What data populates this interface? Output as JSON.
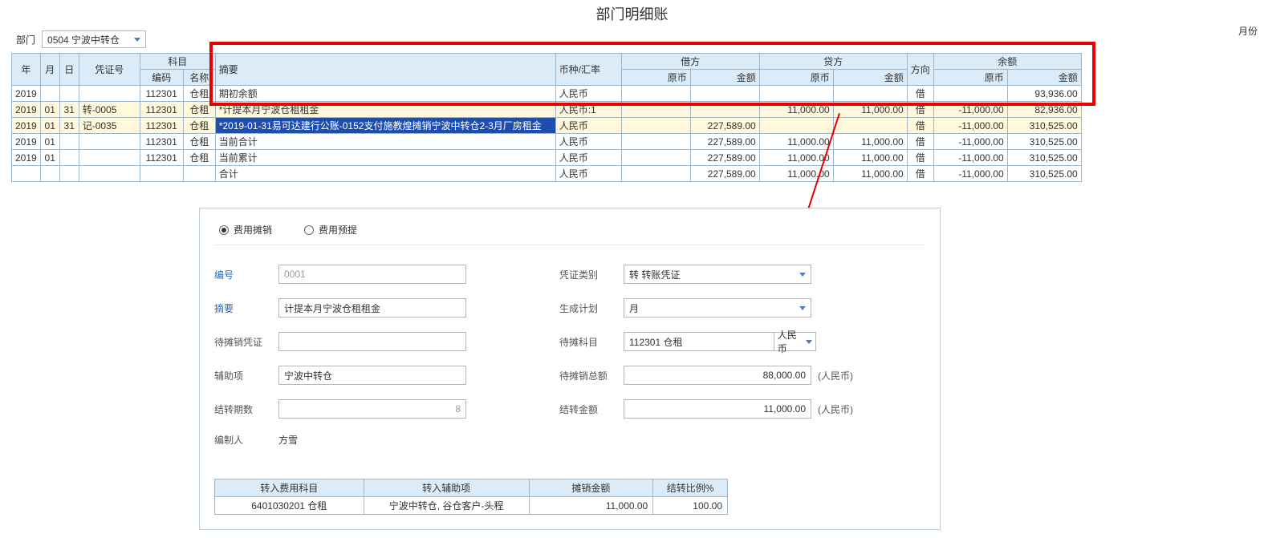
{
  "title": "部门明细账",
  "right_label": "月份",
  "filter": {
    "label": "部门",
    "dept": "0504 宁波中转仓"
  },
  "headers": {
    "year": "年",
    "month": "月",
    "day": "日",
    "voucher": "凭证号",
    "subject": "科目",
    "code": "编码",
    "name": "名称",
    "desc": "摘要",
    "currency": "币种/汇率",
    "debit": "借方",
    "credit": "贷方",
    "orig": "原币",
    "amount": "金额",
    "dir": "方向",
    "balance": "余额"
  },
  "rows": [
    {
      "year": "2019",
      "month": "",
      "day": "",
      "vno": "",
      "code": "112301",
      "name": "仓租",
      "desc": "期初余额",
      "cur": "人民币",
      "od": "",
      "ad": "",
      "oc": "",
      "ac": "",
      "dir": "借",
      "ob": "",
      "ab": "93,936.00",
      "hl": false,
      "sel": false
    },
    {
      "year": "2019",
      "month": "01",
      "day": "31",
      "vno": "转-0005",
      "code": "112301",
      "name": "仓租",
      "desc": "*计提本月宁波仓租租金",
      "cur": "人民币:1",
      "od": "",
      "ad": "",
      "oc": "11,000.00",
      "ac": "11,000.00",
      "dir": "借",
      "ob": "-11,000.00",
      "ab": "82,936.00",
      "hl": true,
      "sel": false
    },
    {
      "year": "2019",
      "month": "01",
      "day": "31",
      "vno": "记-0035",
      "code": "112301",
      "name": "仓租",
      "desc": "*2019-01-31易可达建行公账-0152支付施教煌摊销宁波中转仓2-3月厂房租金",
      "cur": "人民币",
      "od": "",
      "ad": "227,589.00",
      "oc": "",
      "ac": "",
      "dir": "借",
      "ob": "-11,000.00",
      "ab": "310,525.00",
      "hl": true,
      "sel": true
    },
    {
      "year": "2019",
      "month": "01",
      "day": "",
      "vno": "",
      "code": "112301",
      "name": "仓租",
      "desc": "当前合计",
      "cur": "人民币",
      "od": "",
      "ad": "227,589.00",
      "oc": "11,000.00",
      "ac": "11,000.00",
      "dir": "借",
      "ob": "-11,000.00",
      "ab": "310,525.00",
      "hl": false,
      "sel": false
    },
    {
      "year": "2019",
      "month": "01",
      "day": "",
      "vno": "",
      "code": "112301",
      "name": "仓租",
      "desc": "当前累计",
      "cur": "人民币",
      "od": "",
      "ad": "227,589.00",
      "oc": "11,000.00",
      "ac": "11,000.00",
      "dir": "借",
      "ob": "-11,000.00",
      "ab": "310,525.00",
      "hl": false,
      "sel": false
    },
    {
      "year": "",
      "month": "",
      "day": "",
      "vno": "",
      "code": "",
      "name": "",
      "desc": "合计",
      "cur": "人民币",
      "od": "",
      "ad": "227,589.00",
      "oc": "11,000.00",
      "ac": "11,000.00",
      "dir": "借",
      "ob": "-11,000.00",
      "ab": "310,525.00",
      "hl": false,
      "sel": false
    }
  ],
  "radios": {
    "a": "费用摊销",
    "b": "费用预提"
  },
  "form": {
    "no_label": "编号",
    "no": "0001",
    "vtype_label": "凭证类别",
    "vtype": "转  转账凭证",
    "desc_label": "摘要",
    "desc": "计提本月宁波仓租租金",
    "plan_label": "生成计划",
    "plan": "月",
    "pendv_label": "待摊销凭证",
    "pendv": "",
    "subj_label": "待摊科目",
    "subj": "112301  仓租",
    "cur": "人民币",
    "aux_label": "辅助项",
    "aux": "宁波中转仓",
    "total_label": "待摊销总额",
    "total": "88,000.00",
    "unit": "(人民币)",
    "periods_label": "结转期数",
    "periods": "8",
    "carry_label": "结转金额",
    "carry": "11,000.00",
    "maker_label": "编制人",
    "maker": "方雪"
  },
  "res": {
    "h1": "转入费用科目",
    "h2": "转入辅助项",
    "h3": "摊销金额",
    "h4": "结转比例%",
    "c1": "6401030201  仓租",
    "c2": "宁波中转仓, 谷仓客户-头程",
    "c3": "11,000.00",
    "c4": "100.00"
  }
}
